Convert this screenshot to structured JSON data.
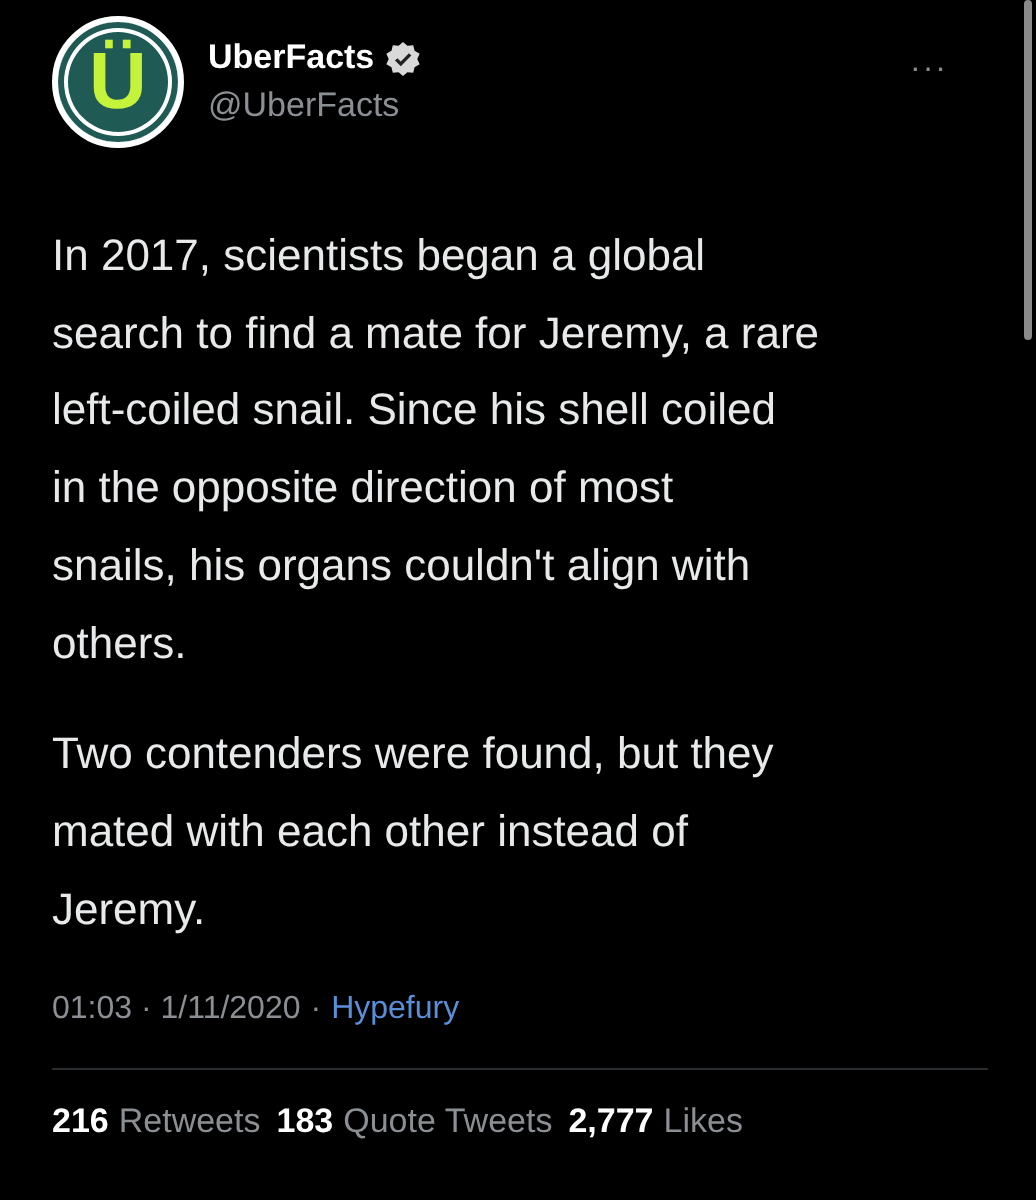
{
  "author": {
    "avatar_letter": "Ü",
    "name": "UberFacts",
    "verified": true,
    "handle": "@UberFacts"
  },
  "more_menu": "···",
  "paragraphs": [
    [
      "In 2017, scientists began a global",
      "search to find a mate for Jeremy, a rare",
      "left-coiled snail. Since his shell coiled",
      "in the opposite direction of most",
      "snails, his organs couldn't align with",
      "others."
    ],
    [
      "Two contenders were found, but they",
      "mated with each other instead of",
      "Jeremy."
    ]
  ],
  "meta": {
    "timestamp": "01:03 · 1/11/2020",
    "separator": "·",
    "source": "Hypefury"
  },
  "stats": [
    {
      "count": "216",
      "label": "Retweets"
    },
    {
      "count": "183",
      "label": "Quote Tweets"
    },
    {
      "count": "2,777",
      "label": "Likes"
    }
  ]
}
